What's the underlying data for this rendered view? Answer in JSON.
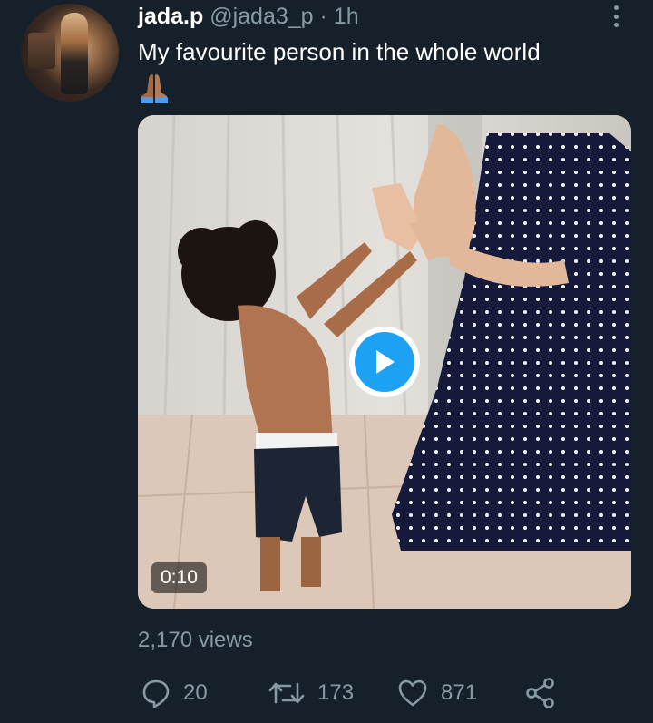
{
  "tweet": {
    "author_name": "jada.p",
    "author_handle": "@jada3_p",
    "separator": "·",
    "time_ago": "1h",
    "text": "My favourite person in the whole world",
    "emoji": "🙏🏽",
    "media": {
      "type": "video",
      "duration": "0:10"
    },
    "views": "2,170 views",
    "actions": {
      "reply_count": "20",
      "retweet_count": "173",
      "like_count": "871"
    }
  },
  "icons": {
    "more": "more-vertical-icon",
    "play": "play-icon",
    "reply": "reply-icon",
    "retweet": "retweet-icon",
    "like": "heart-icon",
    "share": "share-icon"
  },
  "colors": {
    "background": "#15202b",
    "secondary_text": "#8899a6",
    "accent": "#1da1f2"
  }
}
